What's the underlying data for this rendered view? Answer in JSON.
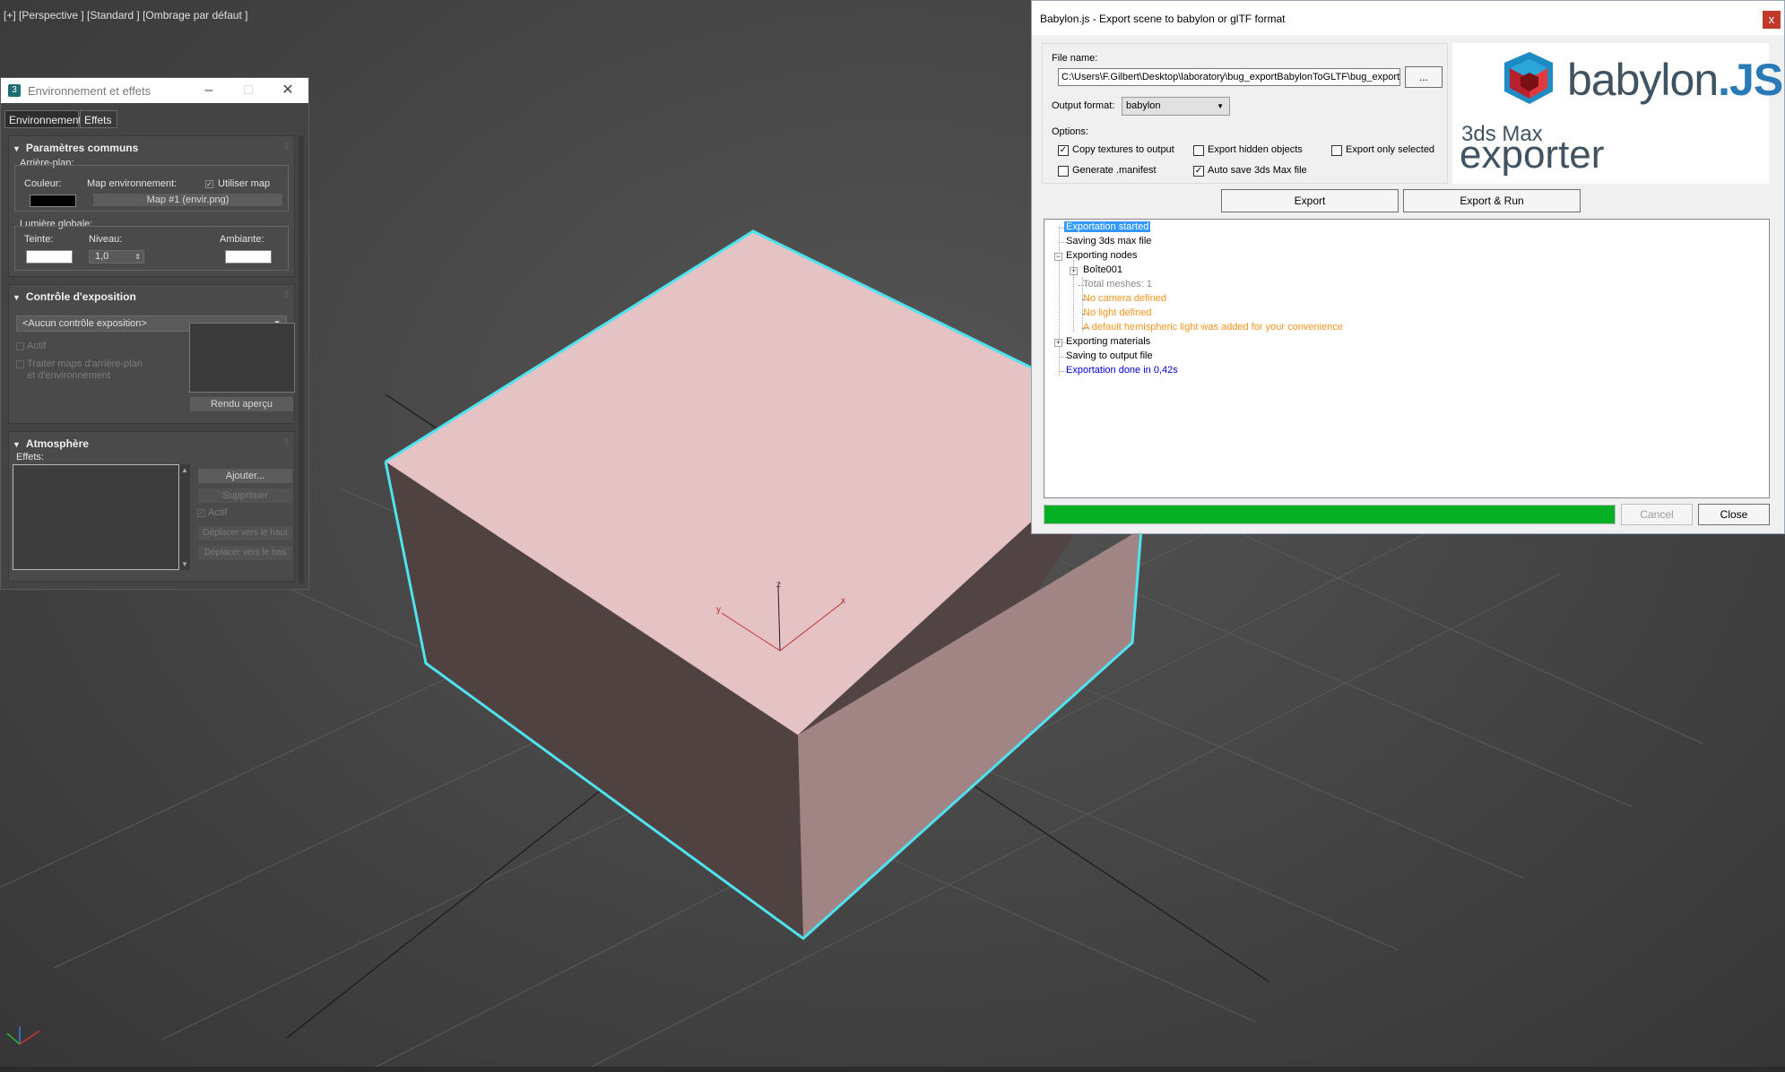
{
  "viewport": {
    "label": "[+] [Perspective ] [Standard ] [Ombrage par défaut ]",
    "axis_x": "x",
    "axis_y": "y",
    "axis_z": "z"
  },
  "env_panel": {
    "title": "Environnement et effets",
    "tabs": [
      "Environnement",
      "Effets"
    ],
    "common": {
      "title": "Paramètres communs",
      "background_group": "Arrière-plan:",
      "color_label": "Couleur:",
      "env_map_label": "Map environnement:",
      "use_map_label": "Utiliser map",
      "map_button": "Map #1 (envir.png)",
      "global_light_group": "Lumière globale:",
      "tint_label": "Teinte:",
      "level_label": "Niveau:",
      "level_value": "1,0",
      "ambient_label": "Ambiante:"
    },
    "exposure": {
      "title": "Contrôle d'exposition",
      "dropdown_value": "<Aucun contrôle exposition>",
      "active_label": "Actif",
      "process_label_1": "Traiter maps d'arrière-plan",
      "process_label_2": "et d'environnement",
      "preview_button": "Rendu aperçu"
    },
    "atmosphere": {
      "title": "Atmosphère",
      "effects_label": "Effets:",
      "add_button": "Ajouter...",
      "delete_button": "Supprimer",
      "active_label": "Actif",
      "move_up_button": "Déplacer vers le haut",
      "move_down_button": "Déplacer vers le bas"
    }
  },
  "dialog": {
    "title": "Babylon.js - Export scene to babylon or glTF format",
    "close_x": "x",
    "file_name_label": "File name:",
    "file_name_value": "C:\\Users\\F.Gilbert\\Desktop\\laboratory\\bug_exportBabylonToGLTF\\bug_export",
    "browse_button": "...",
    "output_format_label": "Output format:",
    "output_format_value": "babylon",
    "options_label": "Options:",
    "options": [
      {
        "label": "Copy textures to output",
        "checked": true
      },
      {
        "label": "Export hidden objects",
        "checked": false
      },
      {
        "label": "Export only selected",
        "checked": false
      },
      {
        "label": "Generate .manifest",
        "checked": false
      },
      {
        "label": "Auto save 3ds Max file",
        "checked": true
      }
    ],
    "logo": {
      "brand": "babylon",
      "brand_suffix": ".JS",
      "line1": "3ds Max",
      "line2": "exporter"
    },
    "export_button": "Export",
    "export_run_button": "Export & Run",
    "log": [
      {
        "text": "Exportation started",
        "style": "selected"
      },
      {
        "text": "Saving 3ds max file",
        "style": "normal"
      },
      {
        "text": "Exporting nodes",
        "style": "normal"
      },
      {
        "text": "Boîte001",
        "style": "normal"
      },
      {
        "text": "Total meshes: 1",
        "style": "gray"
      },
      {
        "text": "No camera defined",
        "style": "orange"
      },
      {
        "text": "No light defined",
        "style": "orange"
      },
      {
        "text": "A default hemispheric light was added for your convenience",
        "style": "orange"
      },
      {
        "text": "Exporting materials",
        "style": "normal"
      },
      {
        "text": "Saving to output file",
        "style": "normal"
      },
      {
        "text": "Exportation done in 0,42s",
        "style": "blue"
      }
    ],
    "progress_fraction": 1.0,
    "cancel_button": "Cancel",
    "close_button": "Close"
  },
  "colors": {
    "selection_cyan": "#4fe3ef",
    "box_top": "#e5c2c4",
    "progress_green": "#06b025",
    "log_orange": "#f5941e",
    "log_blue": "#0000dd"
  }
}
